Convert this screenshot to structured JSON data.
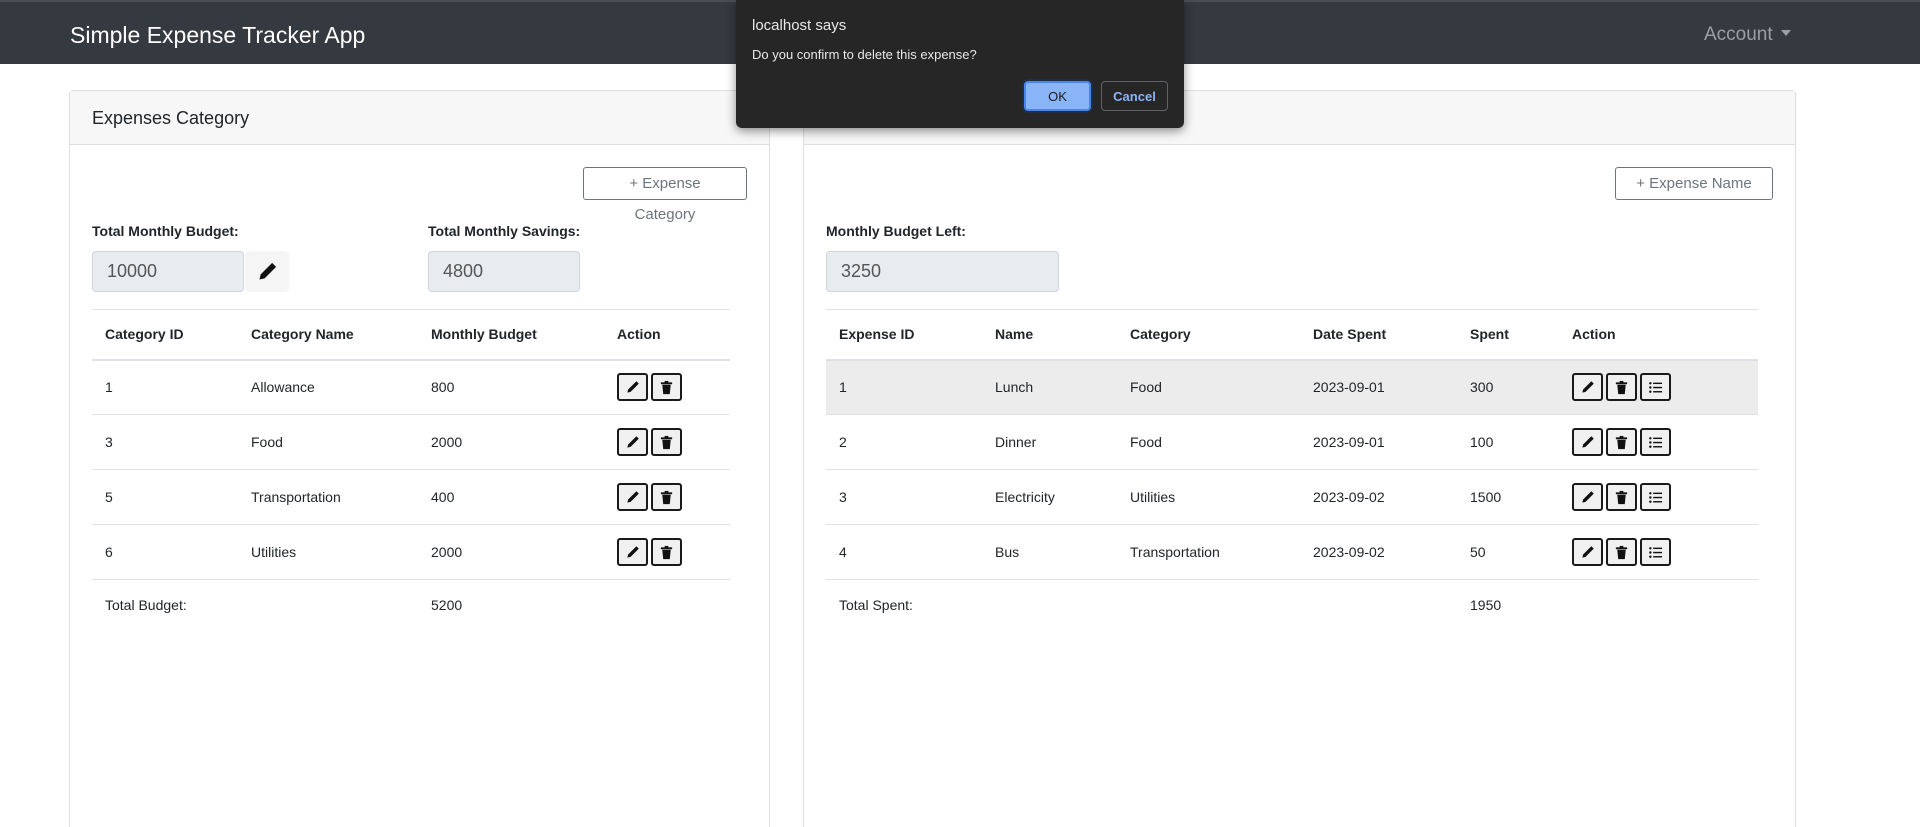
{
  "navbar": {
    "brand": "Simple Expense Tracker App",
    "account": "Account"
  },
  "left_card": {
    "header": "Expenses Category",
    "add_button": "+ Expense Category",
    "budget_label": "Total Monthly Budget:",
    "budget_value": "10000",
    "savings_label": "Total Monthly Savings:",
    "savings_value": "4800",
    "columns": [
      "Category ID",
      "Category Name",
      "Monthly Budget",
      "Action"
    ],
    "rows": [
      {
        "id": "1",
        "name": "Allowance",
        "budget": "800"
      },
      {
        "id": "3",
        "name": "Food",
        "budget": "2000"
      },
      {
        "id": "5",
        "name": "Transportation",
        "budget": "400"
      },
      {
        "id": "6",
        "name": "Utilities",
        "budget": "2000"
      }
    ],
    "total_label": "Total Budget:",
    "total_value": "5200"
  },
  "right_card": {
    "add_button": "+ Expense Name",
    "left_label": "Monthly Budget Left:",
    "left_value": "3250",
    "columns": [
      "Expense ID",
      "Name",
      "Category",
      "Date Spent",
      "Spent",
      "Action"
    ],
    "rows": [
      {
        "id": "1",
        "name": "Lunch",
        "category": "Food",
        "date": "2023-09-01",
        "spent": "300"
      },
      {
        "id": "2",
        "name": "Dinner",
        "category": "Food",
        "date": "2023-09-01",
        "spent": "100"
      },
      {
        "id": "3",
        "name": "Electricity",
        "category": "Utilities",
        "date": "2023-09-02",
        "spent": "1500"
      },
      {
        "id": "4",
        "name": "Bus",
        "category": "Transportation",
        "date": "2023-09-02",
        "spent": "50"
      }
    ],
    "total_label": "Total Spent:",
    "total_value": "1950"
  },
  "dialog": {
    "title": "localhost says",
    "message": "Do you confirm to delete this expense?",
    "ok": "OK",
    "cancel": "Cancel"
  },
  "icons": {
    "edit": "pencil-icon",
    "delete": "trash-icon",
    "details": "list-icon",
    "account_menu": "caret-down-icon"
  },
  "colors": {
    "navbar_bg": "#343a40",
    "dialog_bg": "#262626",
    "dialog_ok": "#8ab4f8",
    "highlight_row": "#ececec"
  }
}
